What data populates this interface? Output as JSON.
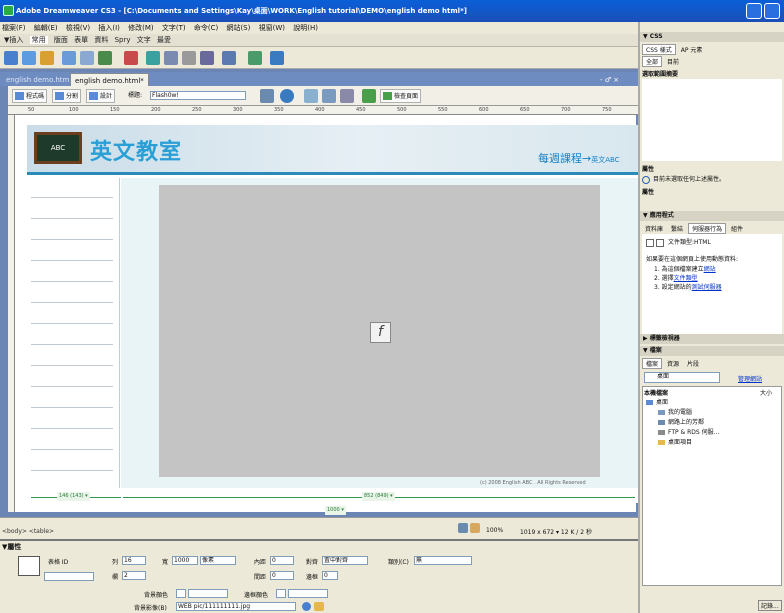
{
  "window": {
    "title": "Adobe Dreamweaver CS3 - [C:\\Documents and Settings\\Kay\\桌面\\WORK\\English tutorial\\DEMO\\english demo html*]"
  },
  "menu": [
    "檔案(F)",
    "編輯(E)",
    "檢視(V)",
    "插入(I)",
    "修改(M)",
    "文字(T)",
    "命令(C)",
    "網站(S)",
    "視窗(W)",
    "說明(H)"
  ],
  "insert_tabs": [
    "▼插入",
    "常用",
    "版面",
    "表單",
    "資料",
    "Spry",
    "文字",
    "最愛"
  ],
  "doc_tabs": [
    "english demo.html",
    "english demo.html*"
  ],
  "doc_toolbar": {
    "code": "程式碼",
    "split": "分割",
    "design": "設計",
    "title_label": "標題:",
    "title_value": "Flash0w!",
    "check_page": "檢查頁面"
  },
  "ruler_ticks": [
    "50",
    "100",
    "150",
    "200",
    "250",
    "300",
    "350",
    "400",
    "450",
    "500",
    "550",
    "600",
    "650",
    "700",
    "750"
  ],
  "page": {
    "board_text": "ABC",
    "logo_text": "英文教室",
    "weekly": "每週課程→",
    "weekly_small": "英文ABC",
    "copyright": "(c) 2008 English ABC . All Rights Reserved",
    "flash_icon": "f"
  },
  "measure": {
    "left": "146 (143) ▾",
    "right": "852 (849) ▾",
    "center": "1000 ▾"
  },
  "status": {
    "tag_selector": "<body> <table>",
    "zoom": "100%",
    "size": "1019 x 672 ▾ 12 K / 2 秒"
  },
  "properties": {
    "header": "▼屬性",
    "swf_label": "表格 ID",
    "rows_label": "列",
    "rows_value": "16",
    "width_label": "寬",
    "width_value": "1000",
    "width_unit": "像素",
    "cols_label": "欄",
    "cols_value": "2",
    "cellpad_label": "內距",
    "cellpad_value": "0",
    "cellspace_label": "間距",
    "cellspace_value": "0",
    "align_label": "對齊",
    "align_value": "置中對齊",
    "border_label": "邊框",
    "border_value": "0",
    "class_label": "類別(C)",
    "class_value": "無",
    "bgcolor_label": "背景顏色",
    "bordercolor_label": "邊框顏色",
    "bgimage_label": "背景影像(B)",
    "bgimage_value": "WEB pic/111111111.jpg"
  },
  "right_panel": {
    "css_header": "▼ CSS",
    "css_tabs": [
      "CSS 樣式",
      "AP 元素"
    ],
    "css_subtabs": [
      "全部",
      "目前"
    ],
    "css_summary": "選取範圍摘要",
    "attr_label": "屬性",
    "attr_msg": "目前未選取任何上述屬性。",
    "props_label": "屬性",
    "app_header": "▼ 應用程式",
    "app_tabs": [
      "資料庫",
      "繫結",
      "伺服器行為",
      "組件"
    ],
    "doctype": "文件類型:HTML",
    "instructions": "如果要在這個網頁上使用動態資料:",
    "step1": "1. 為這個檔案建立",
    "step1_link": "網站",
    "step2": "2. 選擇",
    "step2_link": "文件類型",
    "step3": "3. 設定網站的",
    "step3_link": "測試伺服器",
    "tag_inspector": "▶ 標籤檢視器",
    "files_header": "▼ 檔案",
    "files_tabs": [
      "檔案",
      "資源",
      "片段"
    ],
    "desktop": "桌面",
    "manage": "管理網站",
    "local_files": "本機檔案",
    "size_col": "大小",
    "tree": [
      "桌面",
      "我的電腦",
      "網路上的芳鄰",
      "FTP & RDS 伺服...",
      "桌面項目"
    ],
    "log": "記錄..."
  }
}
